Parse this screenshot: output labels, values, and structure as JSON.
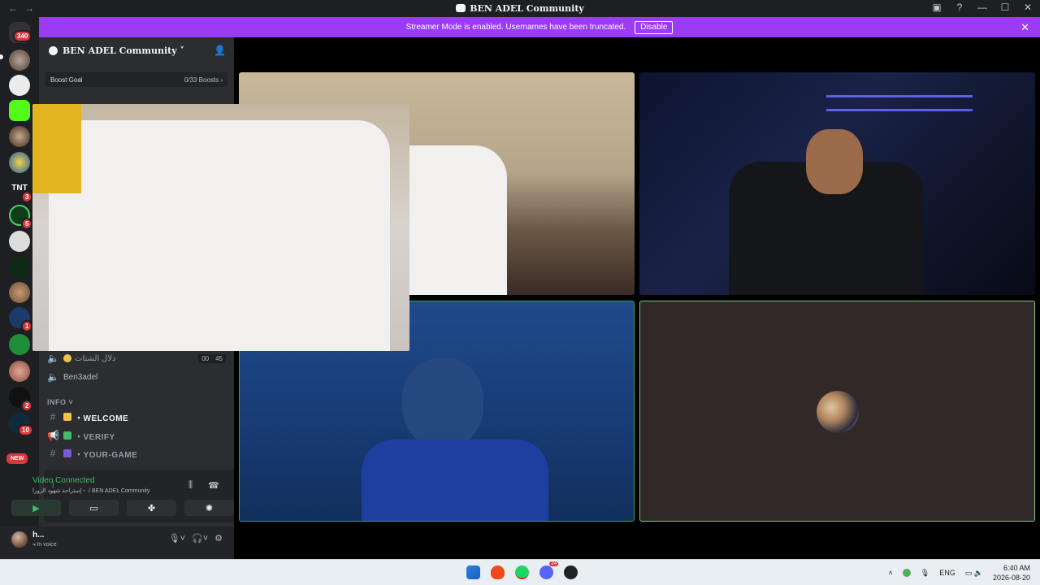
{
  "titlebar": {
    "title": "BEN ADEL Community"
  },
  "banner": {
    "text": "Streamer Mode is enabled. Usernames have been truncated.",
    "disable_label": "Disable"
  },
  "servers": {
    "home_badge": "340",
    "badges": [
      {
        "value": "3"
      },
      {
        "value": "5"
      },
      {
        "value": "1"
      },
      {
        "value": "2"
      },
      {
        "value": "10"
      }
    ],
    "new_label": "NEW",
    "tnt_label": "TNT"
  },
  "guild": {
    "name": "BEN ADEL Community ˅",
    "boost_goal": "Boost Goal",
    "boost_count": "0/33 Boosts ›"
  },
  "channels": {
    "voice_1_name": "دلال الشتات",
    "voice_1_count_a": "00",
    "voice_1_count_b": "45",
    "voice_2_name": "Ben3adel",
    "category": "INFO ˅",
    "welcome": "・WELCOME",
    "verify": "・VERIFY",
    "your_game": "・YOUR-GAME"
  },
  "voice": {
    "status": "Video Connected",
    "location": "إستراحة شهود الزورا・ / BEN ADEL Community"
  },
  "user": {
    "name": "h...",
    "status": "In voice"
  },
  "tray": {
    "lang": "ENG",
    "time": "6:40 AM",
    "date": "2026-08-20"
  },
  "taskbar": {
    "discord_badge": "24"
  },
  "colors": {
    "accent": "#9b3bf5",
    "connected": "#3fbb6a",
    "badge": "#da373c"
  }
}
